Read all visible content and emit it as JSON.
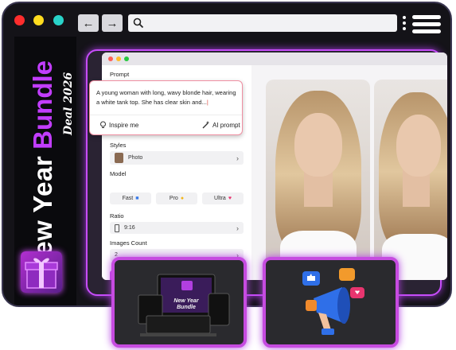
{
  "browser": {
    "dots": [
      "#ff2d2d",
      "#ffdc1f",
      "#29d3c9"
    ],
    "back_icon": "arrow-left-icon",
    "forward_icon": "arrow-right-icon",
    "search_icon": "search-icon",
    "menu_icon": "hamburger-menu-icon"
  },
  "promo": {
    "title_white": "New Year",
    "title_purple": "Bundle",
    "subtitle": "Deal 2026",
    "accent": "#c23dff"
  },
  "app": {
    "prompt_label": "Prompt",
    "prompt_text": "A young woman with long, wavy blonde hair, wearing a white tank top. She has clear skin and...",
    "inspire_label": "Inspire me",
    "ai_prompt_label": "AI prompt",
    "styles_label": "Styles",
    "style_value": "Photo",
    "model_label": "Model",
    "models": [
      "Fast",
      "Pro",
      "Ultra"
    ],
    "ratio_label": "Ratio",
    "ratio_value": "9:16",
    "images_count_label": "Images Count",
    "images_count_value": "2"
  },
  "cards": {
    "left_caption": "New Year Bundle",
    "right_icon": "megaphone-icon"
  }
}
